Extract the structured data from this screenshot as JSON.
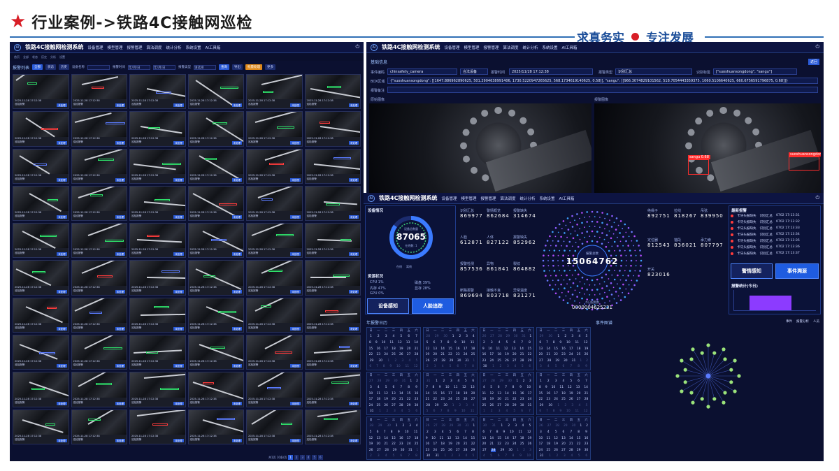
{
  "slide": {
    "title": "行业案例->铁路4C接触网巡检",
    "slogan_left": "求真务实",
    "slogan_right": "专注发展",
    "accent_color": "#d81e26",
    "line_color": "#2f6fb5"
  },
  "system": {
    "logo_text": "AI",
    "name": "铁路4C接触网检测系统",
    "nav": [
      "设备管理",
      "模型管理",
      "报警管理",
      "算法调度",
      "统计分析",
      "系统设置",
      "AI工具箱"
    ]
  },
  "gallery": {
    "tabs": [
      "首页",
      "全部",
      "状态",
      "历史",
      "分析",
      "设置"
    ],
    "filter": {
      "section": "报警列表",
      "label_device": "设备名称",
      "label_time": "报警时间",
      "label_type": "报警类型",
      "date_start": "年/月/日",
      "date_end": "年/月/日",
      "select": "请选择",
      "btn_query": "查询",
      "btn_export": "导出",
      "btn_batch": "批量处理",
      "btn_more": "更多"
    },
    "tile_time": "2025-11-28 17:12:38",
    "tile_status": "未处理",
    "tile_label": "巡检报警",
    "pager": {
      "summary": "共1页 10条/页",
      "pages": [
        "1",
        "2",
        "3",
        "4",
        "5",
        "6"
      ],
      "active": "1"
    }
  },
  "detail": {
    "section_basic": "基础信息",
    "btn_back": "返回",
    "fields": {
      "device_label": "事件编码",
      "device_value": "chinsafety_camera",
      "source_value": "合法设备",
      "time_label": "报警时间",
      "time_value": "2025/11/28 17:12:38",
      "type_label": "报警类型",
      "type_value": "识别汇总",
      "tag_label": "识别标签",
      "tag_value": "[\"suoshuansongdong\", \"sangu\"]",
      "box_label": "BOX区域",
      "box_value": "{\"suoshuansongdong\": [[1647.886962890625, 501.2904638991406, 1730.5220947265625, 568.1734619140625, 0.58]], \"sangu\": [[966.3074829101562, 518.7054443359375, 1060.5106640625, 660.6756591796875, 0.68]]}",
      "note_label": "报警备注"
    },
    "image_left_title": "原始图像",
    "image_right_title": "报警图像",
    "det1": "sangu 0.68",
    "det2": "suoshuansongdong"
  },
  "dashboard": {
    "device_title": "设备情况",
    "device_total": "87065",
    "device_ring_label": "设备总数量",
    "device_online": "在线数: 1",
    "legend_on": "在线",
    "legend_off": "离线",
    "ring_online_pct": 0.85,
    "resource_title": "资源状况",
    "cpu": "CPU 1%",
    "mem": "内存 47%",
    "gpu": "GPU 0%",
    "disk1": "磁盘 39%",
    "disk2": "显存 28%",
    "btn_device_sense": "设备感知",
    "btn_face": "人脸追踪",
    "btn_alarm_sense": "警情感知",
    "btn_event": "事件溯源",
    "stats": [
      {
        "label": "识别汇总",
        "value": "869977"
      },
      {
        "label": "警情概览",
        "value": "862684"
      },
      {
        "label": "报警缺失",
        "value": "314674"
      },
      {
        "label": "人脸",
        "value": "612871"
      },
      {
        "label": "人体",
        "value": "827122"
      },
      {
        "label": "报警缺失",
        "value": "852962"
      },
      {
        "label": "报警检测",
        "value": "857536"
      },
      {
        "label": "异物",
        "value": "861841"
      },
      {
        "label": "裂纹",
        "value": "864882"
      },
      {
        "label": "断路报警",
        "value": "869694"
      },
      {
        "label": "接触不良",
        "value": "803718"
      },
      {
        "label": "异常温度",
        "value": "831271"
      }
    ],
    "right_stats": [
      {
        "label": "绝缘子",
        "value": "892751"
      },
      {
        "label": "拉线",
        "value": "818267"
      },
      {
        "label": "吊弦",
        "value": "839950"
      },
      {
        "label": "定位器",
        "value": "812543"
      },
      {
        "label": "锚段",
        "value": "836021"
      },
      {
        "label": "承力索",
        "value": "807797"
      },
      {
        "label": "开关",
        "value": "823016"
      }
    ],
    "center_total": "15064762",
    "center_label": "报警总数",
    "center_bottom": "0000004625231",
    "center_bottom_label": "今日报警数",
    "latest_title": "最新报警",
    "latest_items": [
      {
        "name": "卡牙头报缺失",
        "type": "识别汇总",
        "time": "0702 17:13:31"
      },
      {
        "name": "卡牙头报缺失",
        "type": "识别汇总",
        "time": "0702 17:13:32"
      },
      {
        "name": "卡牙头报缺失",
        "type": "识别汇总",
        "time": "0702 17:13:33"
      },
      {
        "name": "卡牙头报缺失",
        "type": "识别汇总",
        "time": "0702 17:13:34"
      },
      {
        "name": "卡牙头报缺失",
        "type": "识别汇总",
        "time": "0702 17:13:35"
      },
      {
        "name": "卡牙头报缺失",
        "type": "识别汇总",
        "time": "0702 17:13:36"
      },
      {
        "name": "卡牙头报缺失",
        "type": "识别汇总",
        "time": "0702 17:13:37"
      }
    ],
    "today_title": "报警统计(今日)",
    "today_bar_pct": 0.75
  },
  "calendar": {
    "title": "年报警日历",
    "weekdays": [
      "日",
      "一",
      "二",
      "三",
      "四",
      "五",
      "六"
    ],
    "highlight_day": "28"
  },
  "events": {
    "title": "事件图谱",
    "legend": [
      "事件",
      "报警分析",
      "人员"
    ]
  }
}
